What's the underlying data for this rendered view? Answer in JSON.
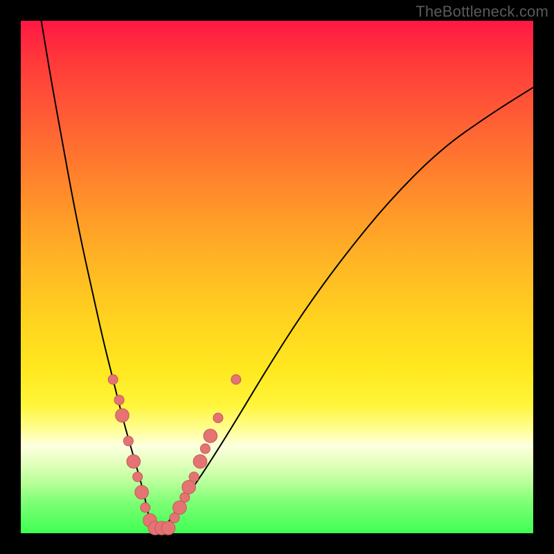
{
  "watermark": "TheBottleneck.com",
  "colors": {
    "frame": "#000000",
    "curve_stroke": "#000000",
    "marker_fill": "#e57373",
    "marker_stroke": "#c05a5a"
  },
  "chart_data": {
    "type": "line",
    "title": "",
    "xlabel": "",
    "ylabel": "",
    "xlim": [
      0,
      100
    ],
    "ylim": [
      0,
      100
    ],
    "grid": false,
    "legend": null,
    "description": "V-shaped bottleneck curve with deep trough near x≈25 on rainbow gradient background",
    "series": [
      {
        "name": "bottleneck-curve",
        "x": [
          4,
          6,
          8,
          10,
          12,
          14,
          16,
          18,
          20,
          22,
          24,
          25,
          26,
          28,
          30,
          33,
          37,
          42,
          48,
          55,
          63,
          72,
          82,
          92,
          100
        ],
        "y": [
          100,
          88,
          77,
          66,
          56,
          47,
          38,
          30,
          22,
          15,
          8,
          3,
          1,
          1,
          4,
          8,
          14,
          22,
          32,
          43,
          54,
          65,
          75,
          82,
          87
        ]
      }
    ],
    "markers": [
      {
        "x": 18.0,
        "y": 30.0,
        "r": 1.0
      },
      {
        "x": 19.2,
        "y": 26.0,
        "r": 1.0
      },
      {
        "x": 19.8,
        "y": 23.0,
        "r": 1.4
      },
      {
        "x": 21.0,
        "y": 18.0,
        "r": 1.0
      },
      {
        "x": 22.0,
        "y": 14.0,
        "r": 1.4
      },
      {
        "x": 22.8,
        "y": 11.0,
        "r": 1.0
      },
      {
        "x": 23.6,
        "y": 8.0,
        "r": 1.4
      },
      {
        "x": 24.3,
        "y": 5.0,
        "r": 1.0
      },
      {
        "x": 25.2,
        "y": 2.5,
        "r": 1.4
      },
      {
        "x": 26.2,
        "y": 1.0,
        "r": 1.4
      },
      {
        "x": 27.5,
        "y": 1.0,
        "r": 1.4
      },
      {
        "x": 28.8,
        "y": 1.0,
        "r": 1.4
      },
      {
        "x": 30.0,
        "y": 3.0,
        "r": 1.0
      },
      {
        "x": 31.0,
        "y": 5.0,
        "r": 1.4
      },
      {
        "x": 32.0,
        "y": 7.0,
        "r": 1.0
      },
      {
        "x": 32.8,
        "y": 9.0,
        "r": 1.4
      },
      {
        "x": 33.8,
        "y": 11.0,
        "r": 1.0
      },
      {
        "x": 35.0,
        "y": 14.0,
        "r": 1.4
      },
      {
        "x": 36.0,
        "y": 16.5,
        "r": 1.0
      },
      {
        "x": 37.0,
        "y": 19.0,
        "r": 1.4
      },
      {
        "x": 38.5,
        "y": 22.5,
        "r": 1.0
      },
      {
        "x": 42.0,
        "y": 30.0,
        "r": 1.0
      }
    ]
  }
}
